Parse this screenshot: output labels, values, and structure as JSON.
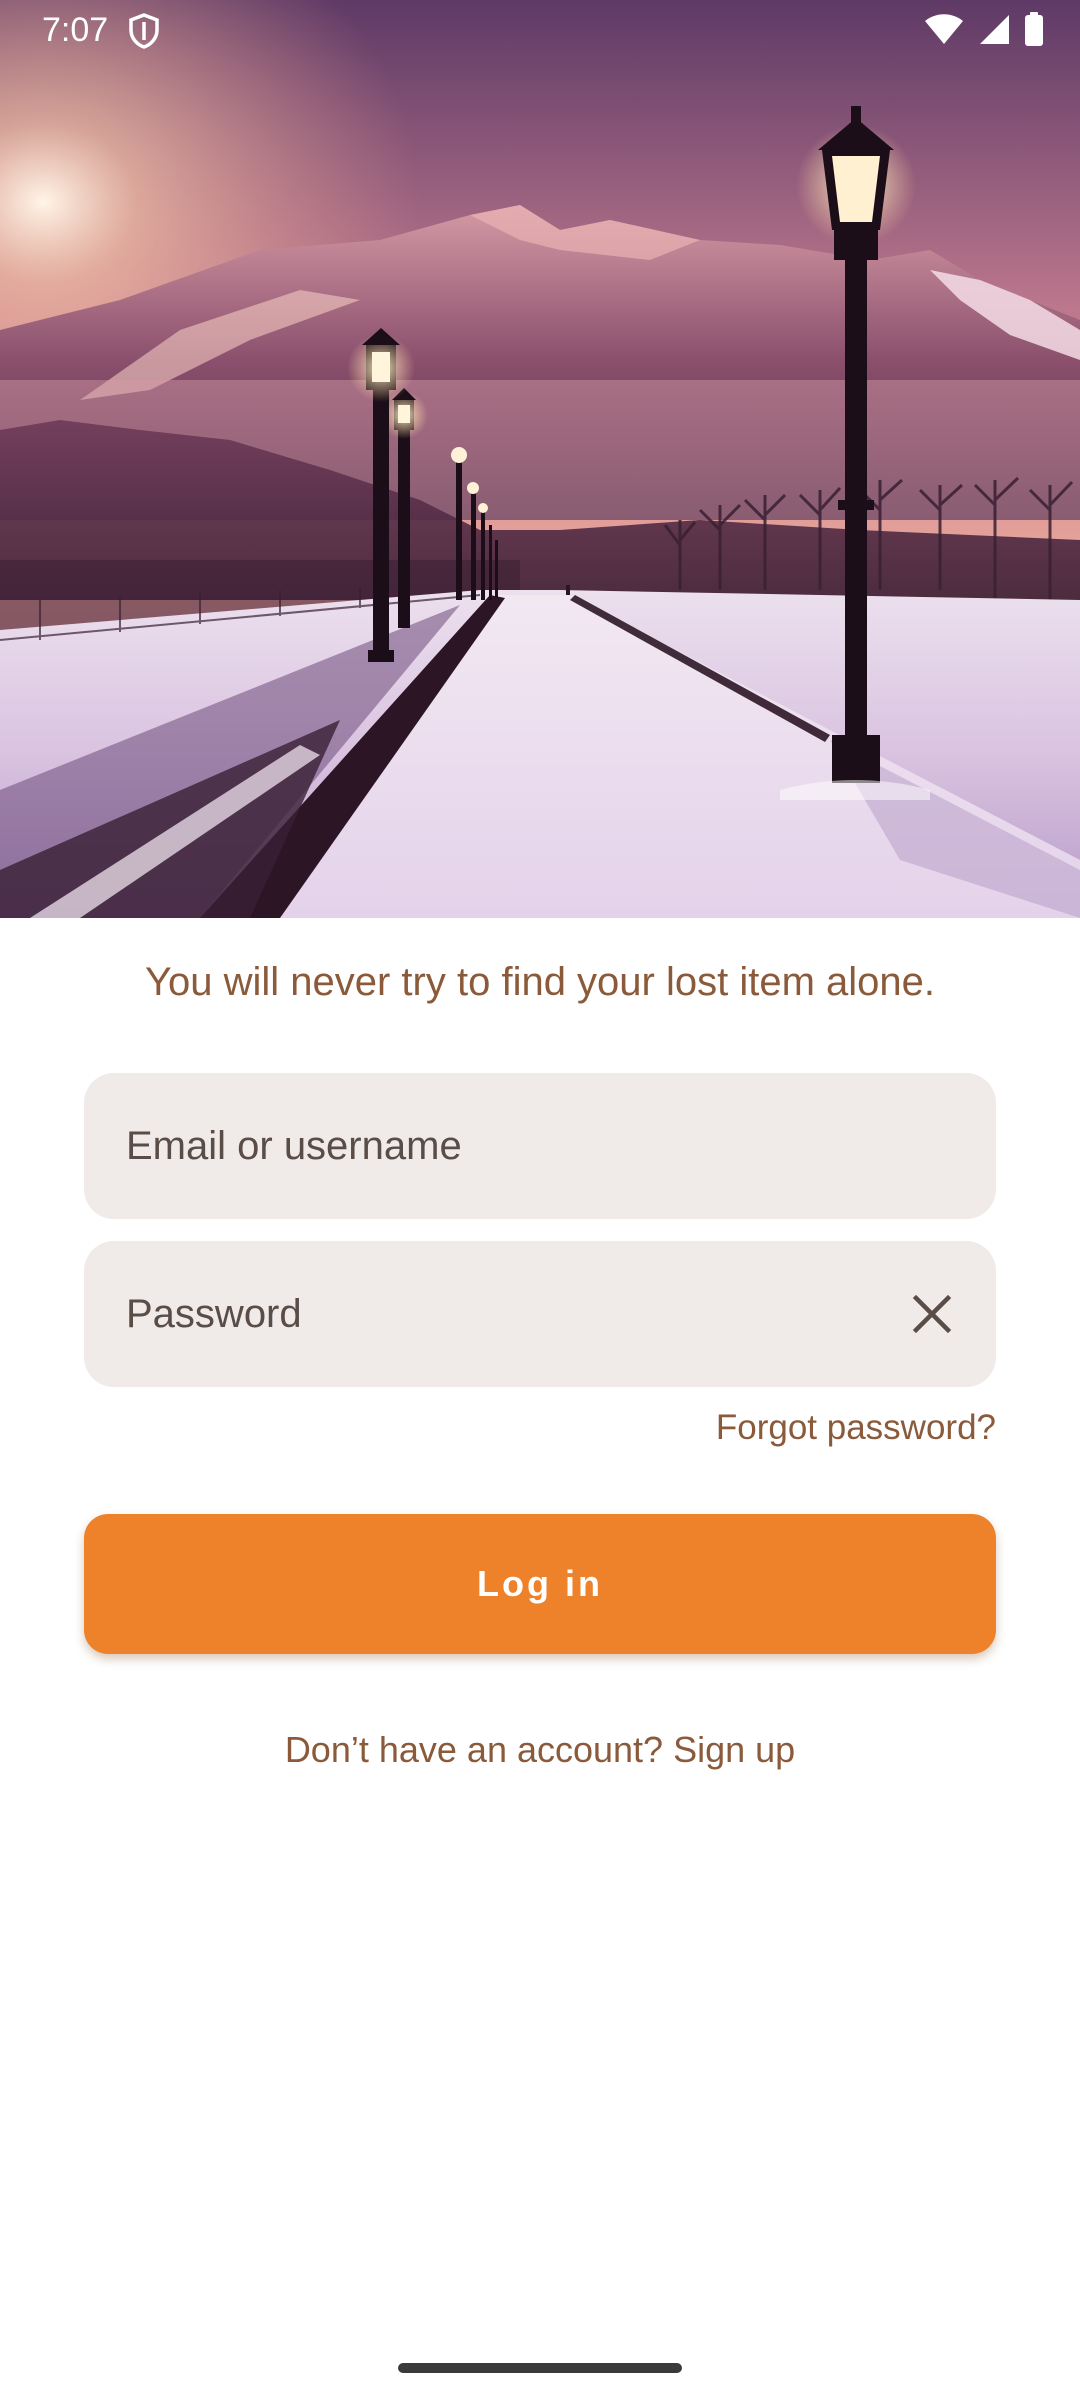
{
  "status_bar": {
    "time": "7:07",
    "icons": [
      "shield-icon",
      "wifi-icon",
      "cellular-signal-icon",
      "battery-icon"
    ]
  },
  "hero": {
    "description_icon": "winter-lamppost-illustration"
  },
  "tagline": "You will never try to find your lost item alone.",
  "form": {
    "email_placeholder": "Email or username",
    "password_placeholder": "Password",
    "forgot_password": "Forgot password?",
    "login_label": "Log in",
    "signup_text": "Don’t have an account? Sign up"
  },
  "colors": {
    "accent": "#ee822a",
    "link_text": "#8a5a3a",
    "field_background": "#f0ebe8",
    "background": "#ffffff"
  }
}
